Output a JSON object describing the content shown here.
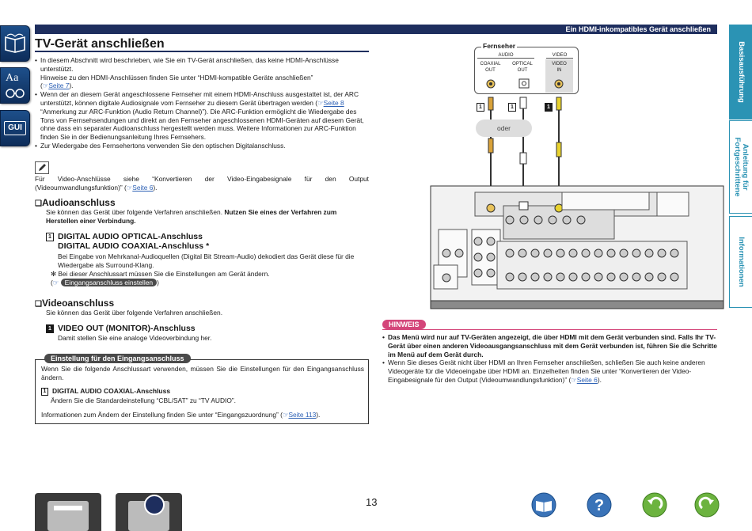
{
  "header": {
    "section_title": "Ein HDMI-inkompatibles Gerät anschließen"
  },
  "sidebar_left": {
    "icons": [
      "book-icon",
      "text-size-icon",
      "gui-icon"
    ],
    "gui_label": "GUI",
    "aa_label": "Aa"
  },
  "tabs_right": [
    {
      "label": "Basisausführung",
      "active": true
    },
    {
      "label": "Anleitung für Fortgeschrittene",
      "active": false
    },
    {
      "label": "Informationen",
      "active": false
    }
  ],
  "page": {
    "title": "TV-Gerät anschließen",
    "intro_bullets": [
      {
        "text": "In diesem Abschnitt wird beschrieben, wie Sie ein TV-Gerät anschließen, das keine HDMI-Anschlüsse unterstützt.",
        "line2": "Hinweise zu den HDMI-Anschlüssen finden Sie unter “HDMI-kompatible Geräte anschließen”",
        "link": "Seite 7"
      },
      {
        "text": "Wenn der an diesem Gerät angeschlossene Fernseher mit einem HDMI-Anschluss ausgestattet ist, der ARC unterstützt, können digitale Audiosignale vom Fernseher zu diesem Gerät übertragen werden",
        "link": "Seite 8",
        "text2": "“Anmerkung zur ARC-Funktion (Audio Return Channel)”). Die ARC-Funktion ermöglicht die Wiedergabe des Tons von Fernsehsendungen und direkt an den Fernseher angeschlossenen HDMI-Geräten auf diesem Gerät, ohne dass ein separater Audioanschluss hergestellt werden muss. Weitere Informationen zur ARC-Funktion finden Sie in der Bedienungsanleitung Ihres Fernsehers."
      },
      {
        "text": "Zur Wiedergabe des Fernsehertons verwenden Sie den optischen Digitalanschluss."
      }
    ],
    "note_text": "Für Video-Anschlüsse siehe “Konvertieren der Video-Eingabesignale für den Output (Videoumwandlungsfunktion)” (",
    "note_link": "Seite 6",
    "audio": {
      "heading": "Audioanschluss",
      "text": "Sie können das Gerät über folgende Verfahren anschließen.",
      "text_bold": "Nutzen Sie eines der Verfahren zum Herstellen einer Verbindung.",
      "item_number": "1",
      "item_title1": "DIGITAL AUDIO OPTICAL-Anschluss",
      "item_title2": "DIGITAL AUDIO COAXIAL-Anschluss *",
      "item_desc": "Bei Eingabe von Mehrkanal-Audioquellen (Digital Bit Stream-Audio) dekodiert das Gerät diese für die Wiedergabe als Surround-Klang.",
      "footnote": "✻ Bei dieser Anschlussart müssen Sie die Einstellungen am Gerät ändern.",
      "footnote_pill": "Eingangsanschluss einstellen"
    },
    "video": {
      "heading": "Videoanschluss",
      "text": "Sie können das Gerät über folgende Verfahren anschließen.",
      "item_number": "1",
      "item_title": "VIDEO OUT (MONITOR)-Anschluss",
      "item_desc": "Damit stellen Sie eine analoge Videoverbindung her."
    },
    "settings_box": {
      "heading": "Einstellung für den Eingangsanschluss",
      "text": "Wenn Sie die folgende Anschlussart verwenden, müssen Sie die Einstellungen für den Eingangsanschluss ändern.",
      "item_number": "1",
      "item_title": "DIGITAL AUDIO COAXIAL-Anschluss",
      "item_desc": "Ändern Sie die Standardeinstellung “CBL/SAT” zu “TV AUDIO”.",
      "footer": "Informationen zum Ändern der Einstellung finden Sie unter “Eingangszuordnung” (",
      "footer_link": "Seite 113"
    },
    "hinweis": {
      "label": "HINWEIS",
      "bullet1": "Das Menü wird nur auf TV-Geräten angezeigt, die über HDMI mit dem Gerät verbunden sind. Falls Ihr TV-Gerät über einen anderen Videoausgangsanschluss mit dem Gerät verbunden ist, führen Sie die Schritte im Menü auf dem Gerät durch.",
      "bullet2": "Wenn Sie dieses Gerät nicht über HDMI an Ihren Fernseher anschließen, schließen Sie auch keine anderen Videogeräte für die Videoeingabe über HDMI an. Einzelheiten finden Sie unter “Konvertieren der Video-Eingabesignale für den Output (Videoumwandlungsfunktion)” (",
      "bullet2_link": "Seite 6"
    },
    "page_number": "13"
  },
  "diagram": {
    "tv_label": "Fernseher",
    "audio_label": "AUDIO",
    "video_label": "VIDEO",
    "coaxial_label1": "COAXIAL",
    "coaxial_label2": "OUT",
    "optical_label1": "OPTICAL",
    "optical_label2": "OUT",
    "video_in_label1": "VIDEO",
    "video_in_label2": "IN",
    "oder_label": "oder",
    "marker1": "1",
    "marker2": "1",
    "marker3": "1"
  },
  "colors": {
    "navy": "#1e2e5e",
    "teal": "#2b93b4",
    "pink": "#d4467a",
    "link": "#2b5fb4"
  }
}
